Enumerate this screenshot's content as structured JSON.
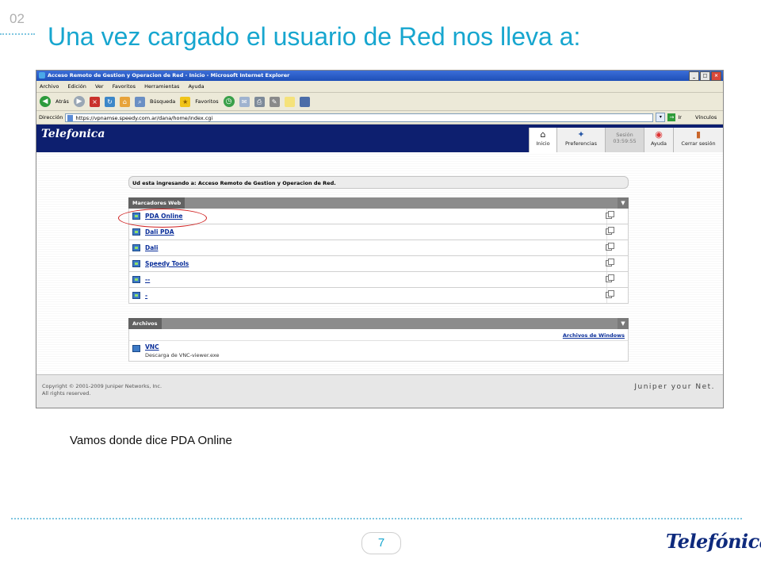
{
  "slide": {
    "section_number": "02",
    "title": "Una vez cargado el usuario de Red nos lleva a:",
    "caption": "Vamos donde dice PDA Online",
    "page_number": "7",
    "brand": "Telefónica"
  },
  "browser": {
    "window_title": "Acceso Remoto de Gestion y Operacion de Red - Inicio - Microsoft Internet Explorer",
    "window_buttons": [
      "_",
      "□",
      "×"
    ],
    "menu": [
      "Archivo",
      "Edición",
      "Ver",
      "Favoritos",
      "Herramientas",
      "Ayuda"
    ],
    "toolbar": {
      "back_label": "Atrás",
      "search_label": "Búsqueda",
      "favorites_label": "Favoritos"
    },
    "address": {
      "label": "Dirección",
      "url": "https://vpnamse.speedy.com.ar/dana/home/index.cgi",
      "go_label": "Ir",
      "links_label": "Vínculos"
    }
  },
  "portal": {
    "logo": "Telefonica",
    "nav": {
      "home": "Inicio",
      "preferences": "Preferencias",
      "session_label": "Sesión",
      "session_time": "03:59:55",
      "help": "Ayuda",
      "logout": "Cerrar sesión"
    },
    "welcome": "Ud esta ingresando a: Acceso Remoto de Gestion y Operacion de Red.",
    "bookmarks_header": "Marcadores Web",
    "bookmarks": [
      {
        "label": "PDA Online"
      },
      {
        "label": "Dali PDA"
      },
      {
        "label": "Dali"
      },
      {
        "label": "Speedy Tools"
      },
      {
        "label": "--"
      },
      {
        "label": "-"
      }
    ],
    "files_header": "Archivos",
    "windows_files_link": "Archivos de Windows",
    "file_item": {
      "label": "VNC",
      "description": "Descarga de VNC-viewer.exe"
    },
    "copyright_line1": "Copyright © 2001-2009 Juniper Networks, Inc.",
    "copyright_line2": "All rights reserved.",
    "footer_brand": "Juniper your Net."
  },
  "colors": {
    "title_blue": "#17a6cf",
    "banner_navy": "#0d1f6f",
    "highlight_red": "#d02020"
  }
}
